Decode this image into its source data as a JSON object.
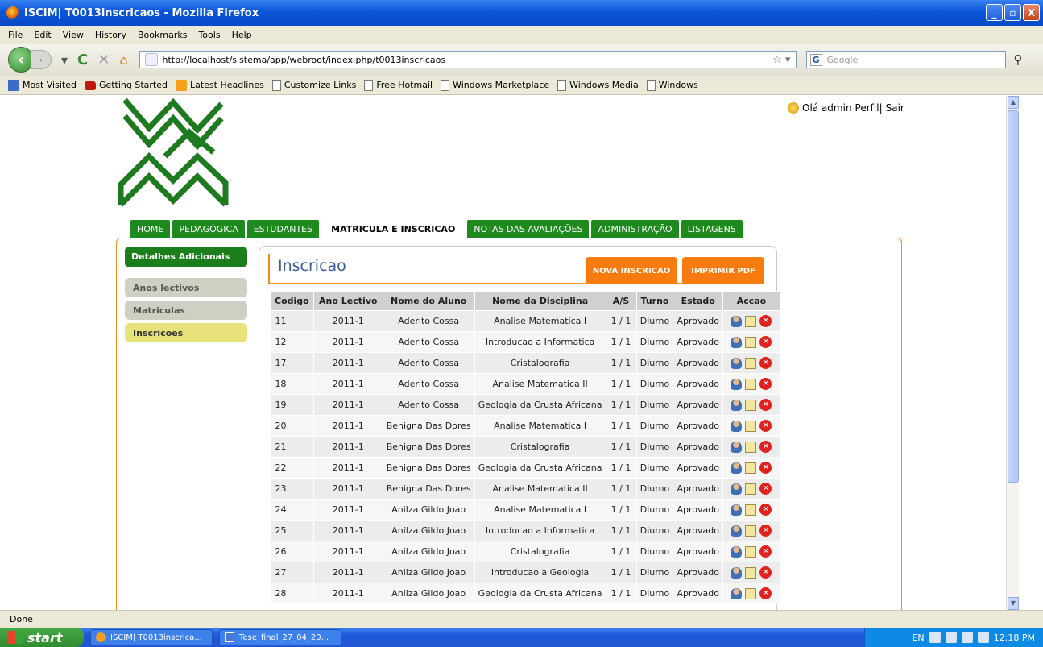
{
  "window": {
    "title": "ISCIM| T0013inscricaos - Mozilla Firefox",
    "buttons": [
      "_",
      "▫",
      "X"
    ]
  },
  "menu": [
    "File",
    "Edit",
    "View",
    "History",
    "Bookmarks",
    "Tools",
    "Help"
  ],
  "toolbar": {
    "url": "http://localhost/sistema/app/webroot/index.php/t0013inscricaos",
    "search_placeholder": "Google"
  },
  "bookmarks": [
    "Most Visited",
    "Getting Started",
    "Latest Headlines",
    "Customize Links",
    "Free Hotmail",
    "Windows Marketplace",
    "Windows Media",
    "Windows"
  ],
  "user": {
    "greeting": "Olá admin",
    "profile": "Perfil|",
    "logout": "Sair"
  },
  "nav": {
    "tabs": [
      "HOME",
      "PEDAGÓGICA",
      "ESTUDANTES",
      "MATRICULA E INSCRICAO",
      "NOTAS DAS AVALIAÇÕES",
      "ADMINISTRAÇÃO",
      "LISTAGENS"
    ],
    "active": "MATRICULA E INSCRICAO"
  },
  "sidebar": {
    "header": "Detalhes Adicionais",
    "items": [
      "Anos lectivos",
      "Matriculas",
      "Inscricoes"
    ],
    "active": "Inscricoes"
  },
  "panel": {
    "title": "Inscricao",
    "new_button": "NOVA INSCRICAO",
    "pdf_button": "IMPRIMIR PDF"
  },
  "table": {
    "headers": [
      "Codigo",
      "Ano Lectivo",
      "Nome do Aluno",
      "Nome da Disciplina",
      "A/S",
      "Turno",
      "Estado",
      "Accao"
    ],
    "rows": [
      [
        "11",
        "2011-1",
        "Aderito Cossa",
        "Analise Matematica I",
        "1 / 1",
        "Diurno",
        "Aprovado"
      ],
      [
        "12",
        "2011-1",
        "Aderito Cossa",
        "Introducao a Informatica",
        "1 / 1",
        "Diurno",
        "Aprovado"
      ],
      [
        "17",
        "2011-1",
        "Aderito Cossa",
        "Cristalografia",
        "1 / 1",
        "Diurno",
        "Aprovado"
      ],
      [
        "18",
        "2011-1",
        "Aderito Cossa",
        "Analise Matematica II",
        "1 / 1",
        "Diurno",
        "Aprovado"
      ],
      [
        "19",
        "2011-1",
        "Aderito Cossa",
        "Geologia da Crusta Africana",
        "1 / 1",
        "Diurno",
        "Aprovado"
      ],
      [
        "20",
        "2011-1",
        "Benigna Das Dores",
        "Analise Matematica I",
        "1 / 1",
        "Diurno",
        "Aprovado"
      ],
      [
        "21",
        "2011-1",
        "Benigna Das Dores",
        "Cristalografia",
        "1 / 1",
        "Diurno",
        "Aprovado"
      ],
      [
        "22",
        "2011-1",
        "Benigna Das Dores",
        "Geologia da Crusta Africana",
        "1 / 1",
        "Diurno",
        "Aprovado"
      ],
      [
        "23",
        "2011-1",
        "Benigna Das Dores",
        "Analise Matematica II",
        "1 / 1",
        "Diurno",
        "Aprovado"
      ],
      [
        "24",
        "2011-1",
        "Anilza Gildo Joao",
        "Analise Matematica I",
        "1 / 1",
        "Diurno",
        "Aprovado"
      ],
      [
        "25",
        "2011-1",
        "Anilza Gildo Joao",
        "Introducao a Informatica",
        "1 / 1",
        "Diurno",
        "Aprovado"
      ],
      [
        "26",
        "2011-1",
        "Anilza Gildo Joao",
        "Cristalografia",
        "1 / 1",
        "Diurno",
        "Aprovado"
      ],
      [
        "27",
        "2011-1",
        "Anilza Gildo Joao",
        "Introducao a Geologia",
        "1 / 1",
        "Diurno",
        "Aprovado"
      ],
      [
        "28",
        "2011-1",
        "Anilza Gildo Joao",
        "Geologia da Crusta Africana",
        "1 / 1",
        "Diurno",
        "Aprovado"
      ]
    ]
  },
  "status": "Done",
  "taskbar": {
    "start": "start",
    "tasks": [
      "ISCIM| T0013inscrica...",
      "Tese_final_27_04_20..."
    ],
    "lang": "EN",
    "clock": "12:18 PM"
  },
  "colors": {
    "green": "#1e8a1e",
    "orange": "#f77b0e",
    "title_blue": "#3b5998"
  }
}
